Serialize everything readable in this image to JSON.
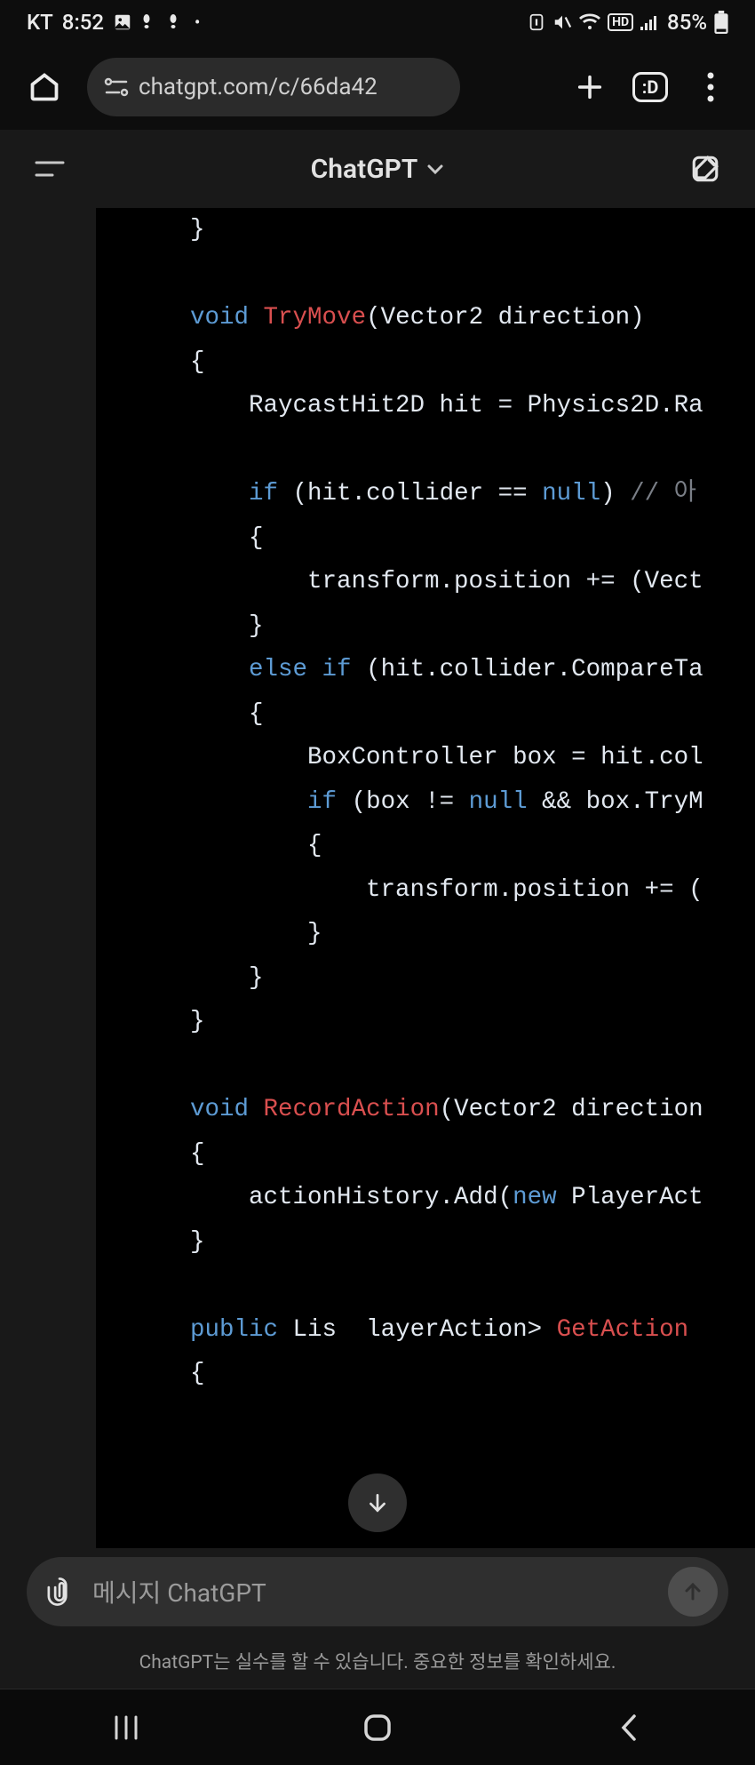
{
  "status": {
    "carrier": "KT",
    "time": "8:52",
    "battery_pct": "85%"
  },
  "browser": {
    "url": "chatgpt.com/c/66da42"
  },
  "app": {
    "title": "ChatGPT"
  },
  "code": {
    "tokens": [
      {
        "t": "    }\n\n    ",
        "c": ""
      },
      {
        "t": "void",
        "c": "kw"
      },
      {
        "t": " ",
        "c": ""
      },
      {
        "t": "TryMove",
        "c": "fn"
      },
      {
        "t": "(Vector2 direction)\n    {\n        RaycastHit2D hit = Physics2D.Ra\n\n        ",
        "c": ""
      },
      {
        "t": "if",
        "c": "kw"
      },
      {
        "t": " (hit.collider == ",
        "c": ""
      },
      {
        "t": "null",
        "c": "kw"
      },
      {
        "t": ") ",
        "c": ""
      },
      {
        "t": "// 아",
        "c": "cm"
      },
      {
        "t": "\n        {\n            transform.position += (Vect\n        }\n        ",
        "c": ""
      },
      {
        "t": "else if",
        "c": "kw"
      },
      {
        "t": " (hit.collider.CompareTa\n        {\n            BoxController box = hit.col\n            ",
        "c": ""
      },
      {
        "t": "if",
        "c": "kw"
      },
      {
        "t": " (box != ",
        "c": ""
      },
      {
        "t": "null",
        "c": "kw"
      },
      {
        "t": " && box.TryM\n            {\n                transform.position += (\n            }\n        }\n    }\n\n    ",
        "c": ""
      },
      {
        "t": "void",
        "c": "kw"
      },
      {
        "t": " ",
        "c": ""
      },
      {
        "t": "RecordAction",
        "c": "fn"
      },
      {
        "t": "(Vector2 direction\n    {\n        actionHistory.Add(",
        "c": ""
      },
      {
        "t": "new",
        "c": "kw"
      },
      {
        "t": " PlayerAct\n    }\n\n    ",
        "c": ""
      },
      {
        "t": "public",
        "c": "kw"
      },
      {
        "t": " Lis  layerAction> ",
        "c": ""
      },
      {
        "t": "GetAction",
        "c": "fn"
      },
      {
        "t": "\n    {",
        "c": ""
      }
    ]
  },
  "input": {
    "placeholder": "메시지 ChatGPT"
  },
  "disclaimer": "ChatGPT는 실수를 할 수 있습니다. 중요한 정보를 확인하세요."
}
